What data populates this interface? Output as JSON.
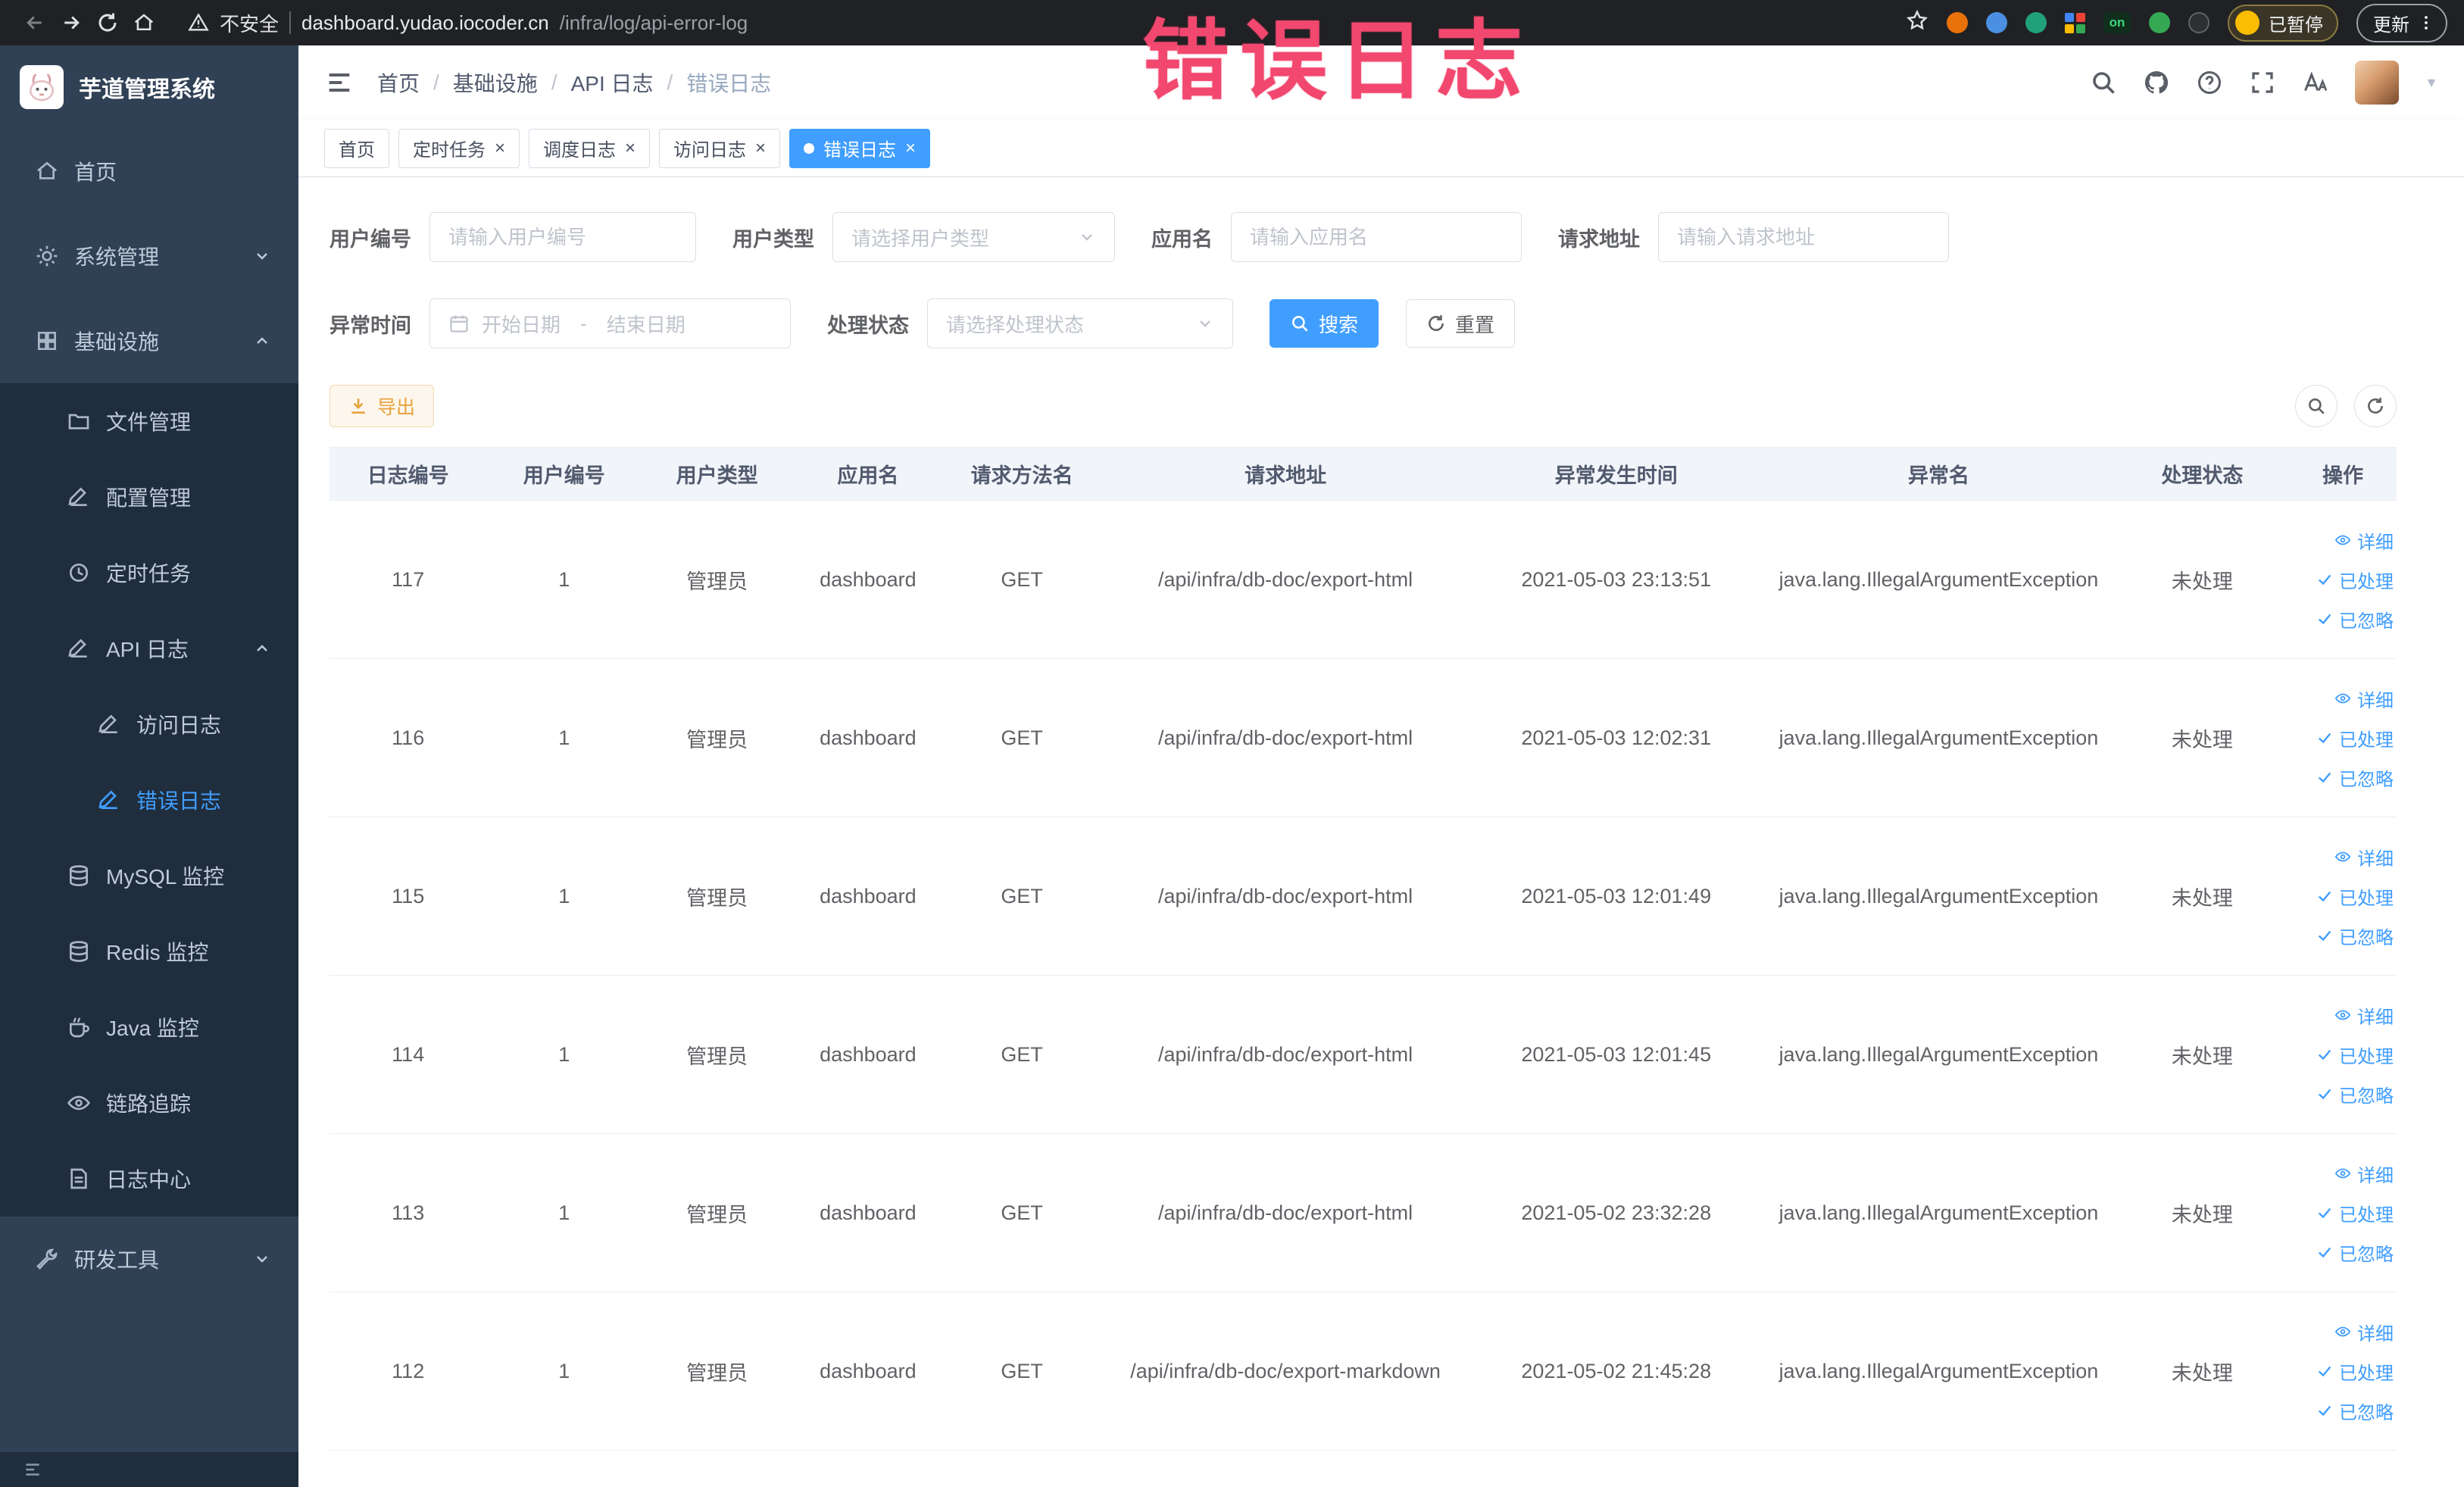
{
  "browser": {
    "security_label": "不安全",
    "url_domain": "dashboard.yudao.iocoder.cn",
    "url_path": "/infra/log/api-error-log",
    "extension_on_label": "on",
    "paused_label": "已暂停",
    "update_label": "更新"
  },
  "watermark": "错误日志",
  "sidebar": {
    "title": "芋道管理系统",
    "items": [
      {
        "label": "首页"
      },
      {
        "label": "系统管理"
      },
      {
        "label": "基础设施"
      },
      {
        "label": "文件管理"
      },
      {
        "label": "配置管理"
      },
      {
        "label": "定时任务"
      },
      {
        "label": "API 日志"
      },
      {
        "label": "访问日志"
      },
      {
        "label": "错误日志"
      },
      {
        "label": "MySQL 监控"
      },
      {
        "label": "Redis 监控"
      },
      {
        "label": "Java 监控"
      },
      {
        "label": "链路追踪"
      },
      {
        "label": "日志中心"
      },
      {
        "label": "研发工具"
      }
    ]
  },
  "breadcrumb": {
    "separator": "/",
    "items": [
      "首页",
      "基础设施",
      "API 日志",
      "错误日志"
    ]
  },
  "tabs": [
    {
      "label": "首页"
    },
    {
      "label": "定时任务"
    },
    {
      "label": "调度日志"
    },
    {
      "label": "访问日志"
    },
    {
      "label": "错误日志"
    }
  ],
  "filters": {
    "user_id": {
      "label": "用户编号",
      "placeholder": "请输入用户编号"
    },
    "user_type": {
      "label": "用户类型",
      "placeholder": "请选择用户类型"
    },
    "app_name": {
      "label": "应用名",
      "placeholder": "请输入应用名"
    },
    "request_url": {
      "label": "请求地址",
      "placeholder": "请输入请求地址"
    },
    "exception_time": {
      "label": "异常时间",
      "start_placeholder": "开始日期",
      "separator": "-",
      "end_placeholder": "结束日期"
    },
    "process_status": {
      "label": "处理状态",
      "placeholder": "请选择处理状态"
    },
    "search_label": "搜索",
    "reset_label": "重置"
  },
  "toolbar": {
    "export_label": "导出"
  },
  "table": {
    "headers": [
      "日志编号",
      "用户编号",
      "用户类型",
      "应用名",
      "请求方法名",
      "请求地址",
      "异常发生时间",
      "异常名",
      "处理状态",
      "操作"
    ],
    "actions": [
      "详细",
      "已处理",
      "已忽略"
    ],
    "rows": [
      {
        "id": "117",
        "user_id": "1",
        "user_type": "管理员",
        "app": "dashboard",
        "method": "GET",
        "url": "/api/infra/db-doc/export-html",
        "time": "2021-05-03 23:13:51",
        "exception": "java.lang.IllegalArgumentException",
        "status": "未处理"
      },
      {
        "id": "116",
        "user_id": "1",
        "user_type": "管理员",
        "app": "dashboard",
        "method": "GET",
        "url": "/api/infra/db-doc/export-html",
        "time": "2021-05-03 12:02:31",
        "exception": "java.lang.IllegalArgumentException",
        "status": "未处理"
      },
      {
        "id": "115",
        "user_id": "1",
        "user_type": "管理员",
        "app": "dashboard",
        "method": "GET",
        "url": "/api/infra/db-doc/export-html",
        "time": "2021-05-03 12:01:49",
        "exception": "java.lang.IllegalArgumentException",
        "status": "未处理"
      },
      {
        "id": "114",
        "user_id": "1",
        "user_type": "管理员",
        "app": "dashboard",
        "method": "GET",
        "url": "/api/infra/db-doc/export-html",
        "time": "2021-05-03 12:01:45",
        "exception": "java.lang.IllegalArgumentException",
        "status": "未处理"
      },
      {
        "id": "113",
        "user_id": "1",
        "user_type": "管理员",
        "app": "dashboard",
        "method": "GET",
        "url": "/api/infra/db-doc/export-html",
        "time": "2021-05-02 23:32:28",
        "exception": "java.lang.IllegalArgumentException",
        "status": "未处理"
      },
      {
        "id": "112",
        "user_id": "1",
        "user_type": "管理员",
        "app": "dashboard",
        "method": "GET",
        "url": "/api/infra/db-doc/export-markdown",
        "time": "2021-05-02 21:45:28",
        "exception": "java.lang.IllegalArgumentException",
        "status": "未处理"
      }
    ]
  }
}
